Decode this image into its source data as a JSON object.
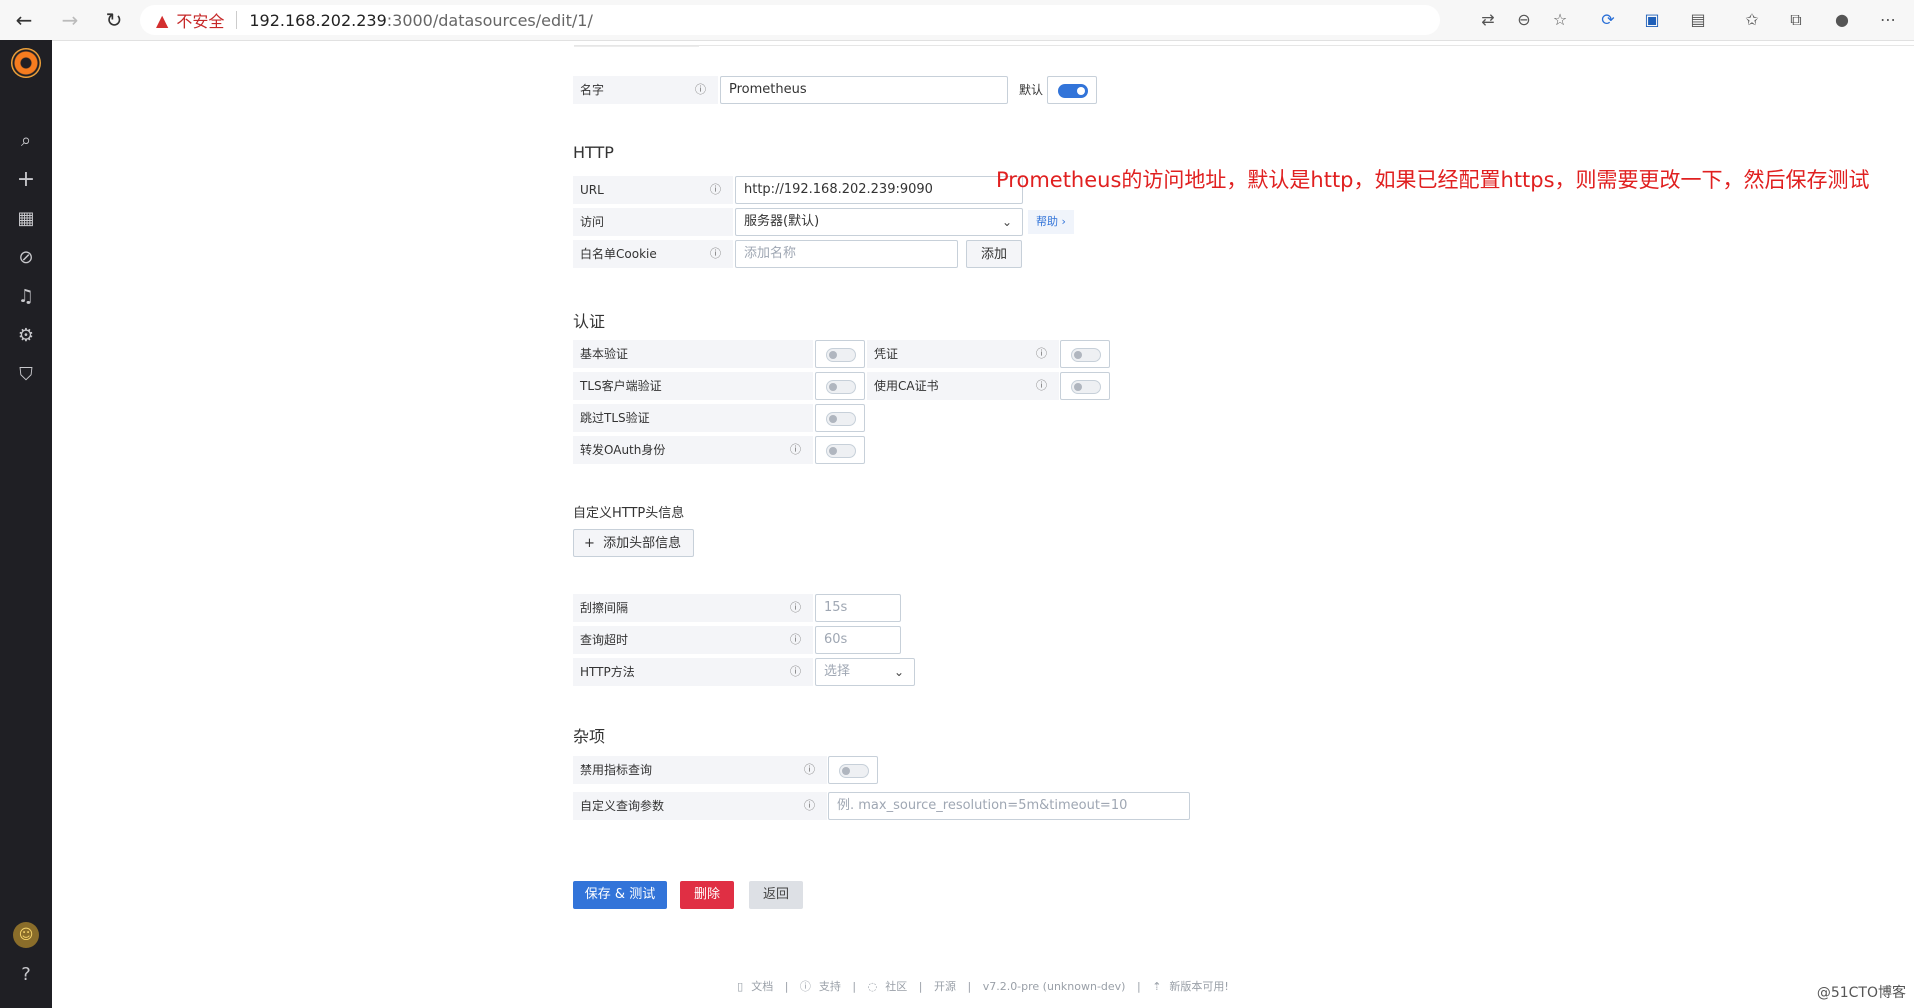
{
  "browser": {
    "insecure_label": "不安全",
    "url_host": "192.168.202.239",
    "url_path": ":3000/datasources/edit/1/"
  },
  "basic": {
    "name_label": "名字",
    "name_value": "Prometheus",
    "default_label": "默认",
    "default_on": true
  },
  "http": {
    "title": "HTTP",
    "url_label": "URL",
    "url_value": "http://192.168.202.239:9090",
    "access_label": "访问",
    "access_value": "服务器(默认)",
    "help_label": "帮助 ›",
    "cookie_label": "白名单Cookie",
    "cookie_placeholder": "添加名称",
    "add_button": "添加"
  },
  "annotation": "Prometheus的访问地址，默认是http，如果已经配置https，则需要更改一下，然后保存测试",
  "auth": {
    "title": "认证",
    "basic_auth": "基本验证",
    "with_credentials": "凭证",
    "tls_client_auth": "TLS客户端验证",
    "with_ca_cert": "使用CA证书",
    "skip_tls": "跳过TLS验证",
    "forward_oauth": "转发OAuth身份"
  },
  "headers": {
    "title": "自定义HTTP头信息",
    "add_button": "添加头部信息"
  },
  "prom": {
    "scrape_label": "刮擦间隔",
    "scrape_placeholder": "15s",
    "timeout_label": "查询超时",
    "timeout_placeholder": "60s",
    "method_label": "HTTP方法",
    "method_placeholder": "选择"
  },
  "misc": {
    "title": "杂项",
    "disable_metrics_label": "禁用指标查询",
    "custom_params_label": "自定义查询参数",
    "custom_params_placeholder": "例. max_source_resolution=5m&timeout=10"
  },
  "actions": {
    "save_test": "保存 & 测试",
    "delete": "删除",
    "back": "返回"
  },
  "footer": {
    "docs": "文档",
    "support": "支持",
    "community": "社区",
    "open_source": "开源",
    "version": "v7.2.0-pre (unknown-dev)",
    "new_version": "新版本可用!"
  },
  "watermark": "@51CTO博客",
  "colors": {
    "primary": "#3274d9",
    "danger": "#e02f44",
    "annotation": "#e02020"
  }
}
